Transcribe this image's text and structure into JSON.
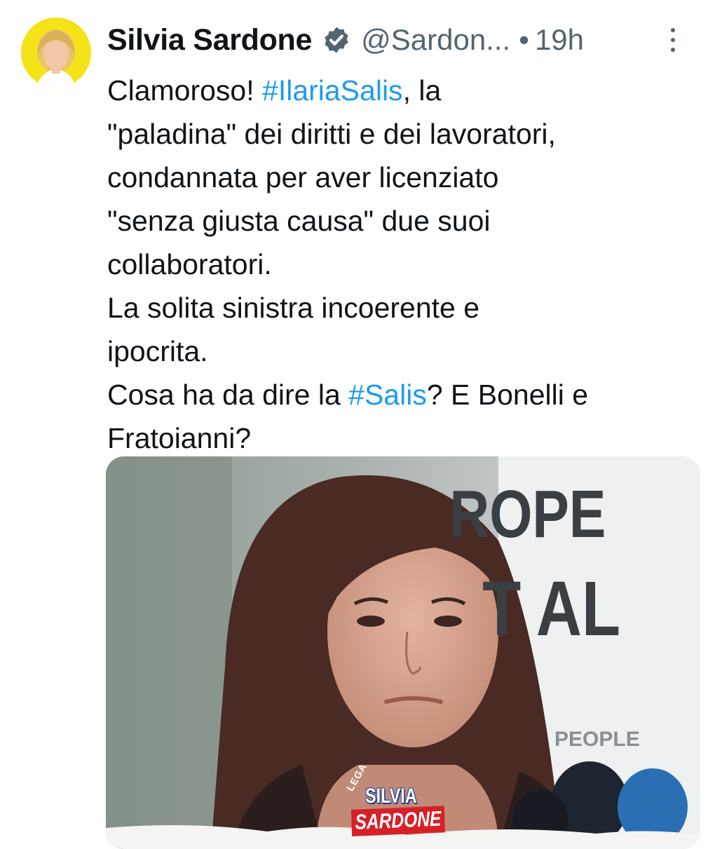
{
  "author": {
    "name": "Silvia Sardone",
    "handle": "@Sardon...",
    "separator": "•",
    "time": "19h",
    "verified": true,
    "avatar_bg": "#f5e31a"
  },
  "tweet": {
    "lines": [
      [
        {
          "t": "Clamoroso! "
        },
        {
          "t": "#IlariaSalis",
          "tag": true
        },
        {
          "t": ", la"
        }
      ],
      [
        {
          "t": "\"paladina\" dei diritti e dei lavoratori,"
        }
      ],
      [
        {
          "t": "condannata per aver licenziato"
        }
      ],
      [
        {
          "t": "\"senza giusta causa\" due suoi"
        }
      ],
      [
        {
          "t": "collaboratori."
        }
      ],
      [
        {
          "t": "La solita sinistra incoerente e"
        }
      ],
      [
        {
          "t": "ipocrita."
        }
      ],
      [
        {
          "t": "Cosa ha da dire la "
        },
        {
          "t": "#Salis",
          "tag": true
        },
        {
          "t": "? E Bonelli e"
        }
      ],
      [
        {
          "t": "Fratoianni?"
        }
      ]
    ]
  },
  "media": {
    "banner_text_1": "ROPE",
    "banner_text_2": "T AL",
    "banner_text_3": "PEOPLE",
    "logo_small": "LEGA",
    "logo_line_1": "SILVIA",
    "logo_line_2": "SARDONE"
  },
  "icons": {
    "verified": "verified-badge-icon",
    "more": "more-vertical-icon"
  },
  "colors": {
    "hashtag": "#1d9bf0",
    "muted": "#536471",
    "text": "#0f1419",
    "logo_red": "#d62028",
    "logo_blue": "#1b3a8a"
  }
}
